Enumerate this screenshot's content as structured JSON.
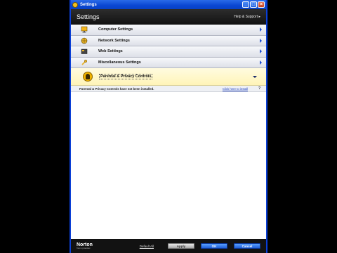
{
  "window": {
    "title": "Settings",
    "controls": [
      "_",
      "□",
      "×"
    ]
  },
  "header": {
    "title": "Settings",
    "help_link": "Help & Support ▸"
  },
  "settings_rows": [
    {
      "label": "Computer Settings",
      "icon": "monitor-icon"
    },
    {
      "label": "Network Settings",
      "icon": "globe-network-icon"
    },
    {
      "label": "Web Settings",
      "icon": "web-folder-icon"
    },
    {
      "label": "Miscellaneous Settings",
      "icon": "wrench-icon"
    }
  ],
  "parental": {
    "label": "Parental & Privacy Controls",
    "icon": "parental-controls-icon",
    "message": "Parental & Privacy Controls have not been installed.",
    "install_link": "Click here to install",
    "help": "?"
  },
  "footer": {
    "brand": "Norton",
    "brand_sub": "from symantec",
    "default_all": "Default All",
    "apply": "Apply",
    "ok": "OK",
    "cancel": "Cancel"
  },
  "colors": {
    "accent": "#1f5fd8",
    "titlebar": "#0a47d2",
    "header": "#1a1a1a",
    "highlight_row": "#fff4b8"
  }
}
